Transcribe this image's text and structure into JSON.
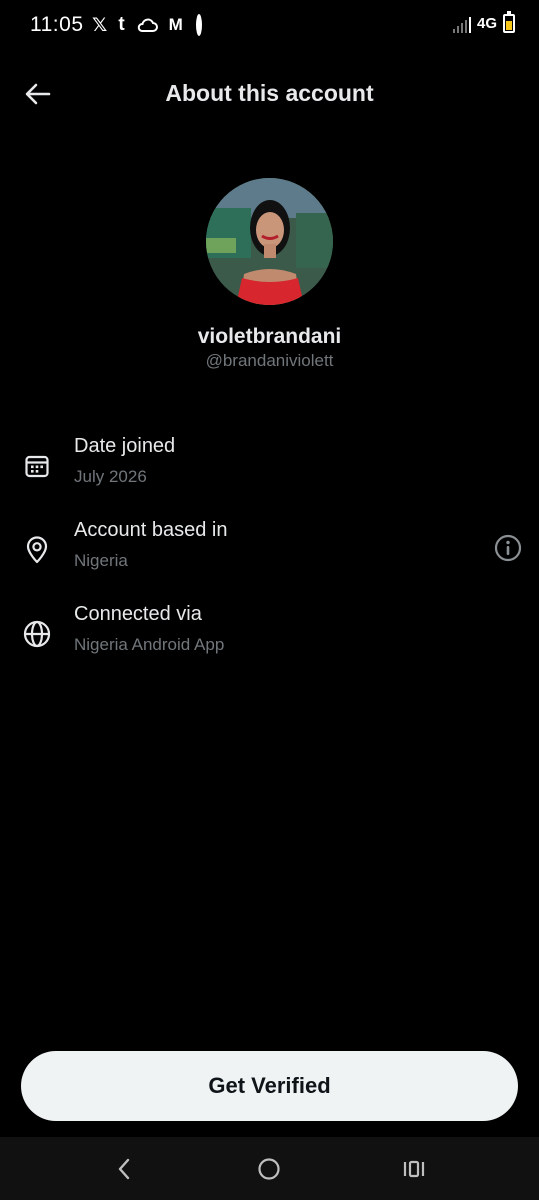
{
  "status_bar": {
    "time": "11:05",
    "left_icons": [
      "x-logo-icon",
      "tumblr-icon",
      "cloud-icon",
      "gmail-icon",
      "dot-icon"
    ],
    "x_glyph": "𝕏",
    "tumblr_glyph": "t",
    "gmail_glyph": "M",
    "network": "4G",
    "battery_color": "#f5c518"
  },
  "header": {
    "title": "About this account",
    "back_icon": "arrow-left-icon"
  },
  "profile": {
    "display_name": "violetbrandani",
    "handle": "@brandaniviolett",
    "avatar_icon": "profile-photo"
  },
  "info": {
    "date_joined": {
      "icon": "calendar-icon",
      "label": "Date joined",
      "value": "July 2026"
    },
    "account_based": {
      "icon": "location-pin-icon",
      "label": "Account based in",
      "value": "Nigeria",
      "extra_icon": "info-circle-icon"
    },
    "connected_via": {
      "icon": "globe-icon",
      "label": "Connected via",
      "value": "Nigeria Android App"
    }
  },
  "cta": {
    "label": "Get Verified"
  },
  "nav_bar": {
    "back_icon": "chevron-left-icon",
    "home_icon": "circle-home-icon",
    "recents_icon": "recents-icon"
  },
  "colors": {
    "background": "#000000",
    "primary_text": "#e7e9ea",
    "secondary_text": "#71767b",
    "button_bg": "#eff3f4",
    "button_text": "#0f1419"
  }
}
